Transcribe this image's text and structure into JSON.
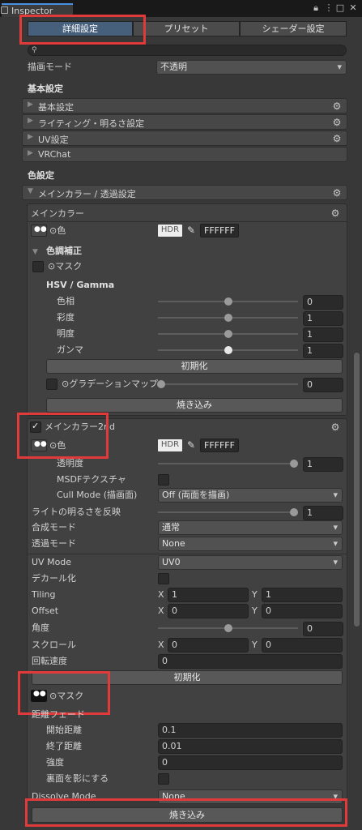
{
  "window": {
    "tab_title": "Inspector"
  },
  "toolbar": {
    "tabs": [
      "詳細設定",
      "プリセット",
      "シェーダー設定"
    ],
    "search_value": ""
  },
  "render_mode": {
    "label": "描画モード",
    "value": "不透明"
  },
  "basic": {
    "heading": "基本設定",
    "folds": [
      "基本設定",
      "ライティング・明るさ設定",
      "UV設定",
      "VRChat"
    ]
  },
  "color": {
    "heading": "色設定",
    "fold": "メインカラー / 透過設定",
    "main": {
      "title": "メインカラー",
      "color_label": "⊙色",
      "hdr": "HDR",
      "hex": "FFFFFF",
      "tone_heading": "色調補正",
      "mask_label": "⊙マスク",
      "hsv_heading": "HSV / Gamma",
      "sliders": [
        {
          "label": "色相",
          "value": "0",
          "level": 0.5
        },
        {
          "label": "彩度",
          "value": "1",
          "level": 0.5
        },
        {
          "label": "明度",
          "value": "1",
          "level": 0.5
        },
        {
          "label": "ガンマ",
          "value": "1",
          "level": 0.5
        }
      ],
      "reset": "初期化",
      "gradation_label": "⊙グラデーションマップ",
      "gradation_value": "0",
      "bake": "焼き込み"
    },
    "second": {
      "title": "メインカラー2nd",
      "color_label": "⊙色",
      "hdr": "HDR",
      "hex": "FFFFFF",
      "opacity_label": "透明度",
      "opacity_value": "1",
      "msdf_label": "MSDFテクスチャ",
      "cull_label": "Cull Mode (描画面)",
      "cull_value": "Off (両面を描画)",
      "light_label": "ライトの明るさを反映",
      "light_value": "1",
      "blend_label": "合成モード",
      "blend_value": "通常",
      "alpha_label": "透過モード",
      "alpha_value": "None",
      "uvmode_label": "UV Mode",
      "uvmode_value": "UV0",
      "decal_label": "デカール化",
      "tiling_label": "Tiling",
      "tiling_x": "1",
      "tiling_y": "1",
      "offset_label": "Offset",
      "offset_x": "0",
      "offset_y": "0",
      "angle_label": "角度",
      "angle_value": "0",
      "scroll_label": "スクロール",
      "scroll_x": "0",
      "scroll_y": "0",
      "rot_label": "回転速度",
      "rot_value": "0",
      "reset": "初期化",
      "mask_label": "⊙マスク",
      "fade_heading": "距離フェード",
      "fade_start_label": "開始距離",
      "fade_start_value": "0.1",
      "fade_end_label": "終了距離",
      "fade_end_value": "0.01",
      "strength_label": "強度",
      "strength_value": "0",
      "backface_label": "裏面を影にする",
      "dissolve_label": "Dissolve Mode",
      "dissolve_value": "None",
      "bake": "焼き込み"
    }
  },
  "axis": {
    "x": "X",
    "y": "Y"
  },
  "icons": {
    "lock": "lock-icon",
    "menu": "kebab-menu-icon",
    "maximize": "maximize-icon",
    "gear": "gear-icon",
    "search": "search-icon"
  },
  "colors": {
    "selected_tab": "#46607c",
    "highlight": "#e03a3a"
  }
}
